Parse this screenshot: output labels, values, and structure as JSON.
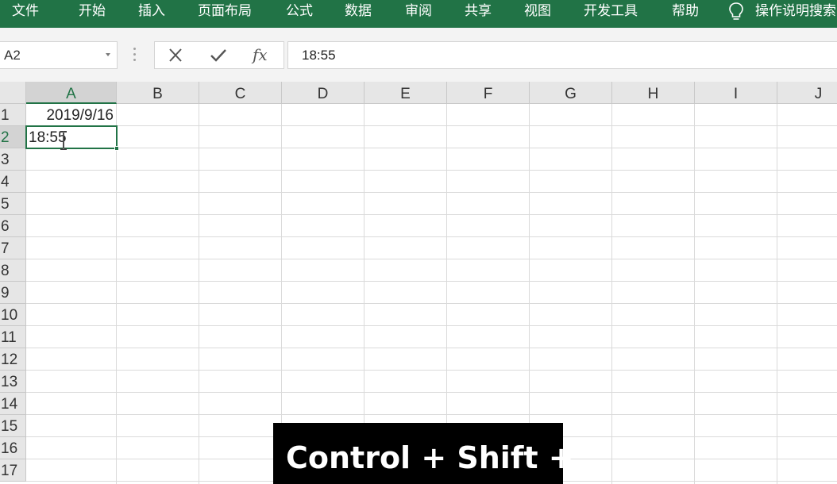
{
  "ribbon": {
    "tabs": [
      "文件",
      "开始",
      "插入",
      "页面布局",
      "公式",
      "数据",
      "审阅",
      "共享",
      "视图",
      "开发工具",
      "帮助"
    ],
    "tell_me": "操作说明搜索",
    "bg_color": "#217346"
  },
  "formula_bar": {
    "name_box": "A2",
    "fx_label": "fx",
    "content": "18:55"
  },
  "sheet": {
    "columns": [
      "A",
      "B",
      "C",
      "D",
      "E",
      "F",
      "G",
      "H",
      "I",
      "J"
    ],
    "rows": [
      "1",
      "2",
      "3",
      "4",
      "5",
      "6",
      "7",
      "8",
      "9",
      "10",
      "11",
      "12",
      "13",
      "14",
      "15",
      "16",
      "17"
    ],
    "selected_cell": "A2",
    "cells": {
      "A1": "2019/9/16",
      "A2": "18:55"
    }
  },
  "overlay": {
    "shortcut": "Control + Shift + ;"
  }
}
